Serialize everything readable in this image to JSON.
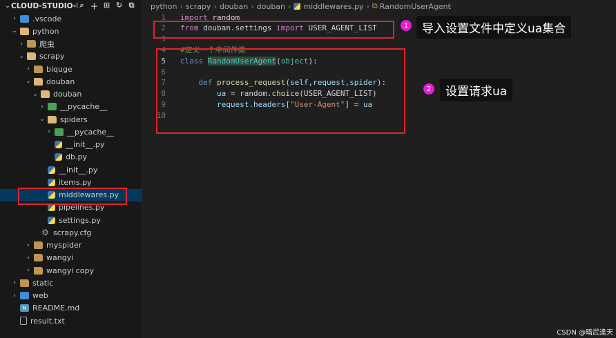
{
  "sidebar": {
    "title": "CLOUD-STUDIO-P...",
    "actions": [
      "search-icon",
      "new-file-icon",
      "new-folder-icon",
      "refresh-icon",
      "collapse-icon"
    ],
    "items": [
      {
        "label": ".vscode",
        "icon": "folder-vscode-icon",
        "chevron": "collapsed"
      },
      {
        "label": "python",
        "icon": "folder-icon",
        "chevron": "expanded"
      },
      {
        "label": "爬虫",
        "icon": "folder-icon",
        "chevron": "collapsed"
      },
      {
        "label": "scrapy",
        "icon": "folder-icon",
        "chevron": "expanded"
      },
      {
        "label": "biquge",
        "icon": "folder-icon",
        "chevron": "collapsed"
      },
      {
        "label": "douban",
        "icon": "folder-icon",
        "chevron": "expanded"
      },
      {
        "label": "douban",
        "icon": "folder-icon",
        "chevron": "expanded"
      },
      {
        "label": "__pycache__",
        "icon": "folder-pycache-icon",
        "chevron": "collapsed"
      },
      {
        "label": "spiders",
        "icon": "folder-icon",
        "chevron": "expanded"
      },
      {
        "label": "__pycache__",
        "icon": "folder-pycache-icon",
        "chevron": "collapsed"
      },
      {
        "label": "__init__.py",
        "icon": "python-file-icon"
      },
      {
        "label": "db.py",
        "icon": "python-file-icon"
      },
      {
        "label": "__init__.py",
        "icon": "python-file-icon"
      },
      {
        "label": "items.py",
        "icon": "python-file-icon"
      },
      {
        "label": "middlewares.py",
        "icon": "python-file-icon",
        "selected": true
      },
      {
        "label": "pipelines.py",
        "icon": "python-file-icon"
      },
      {
        "label": "settings.py",
        "icon": "python-file-icon"
      },
      {
        "label": "scrapy.cfg",
        "icon": "gear-icon"
      },
      {
        "label": "myspider",
        "icon": "folder-icon",
        "chevron": "collapsed"
      },
      {
        "label": "wangyi",
        "icon": "folder-icon",
        "chevron": "collapsed"
      },
      {
        "label": "wangyi copy",
        "icon": "folder-icon",
        "chevron": "collapsed"
      },
      {
        "label": "static",
        "icon": "folder-icon",
        "chevron": "collapsed"
      },
      {
        "label": "web",
        "icon": "folder-vscode-icon",
        "chevron": "collapsed"
      },
      {
        "label": "README.md",
        "icon": "markdown-file-icon"
      },
      {
        "label": "result.txt",
        "icon": "text-file-icon"
      }
    ]
  },
  "breadcrumb": [
    "python",
    "scrapy",
    "douban",
    "douban",
    "middlewares.py",
    "RandomUserAgent"
  ],
  "editor": {
    "active_line": 5,
    "lines": [
      {
        "n": "1",
        "tokens": [
          [
            "kw2",
            "import"
          ],
          [
            "txt",
            " random"
          ]
        ]
      },
      {
        "n": "2",
        "tokens": [
          [
            "kw2",
            "from"
          ],
          [
            "txt",
            " douban.settings "
          ],
          [
            "kw2",
            "import"
          ],
          [
            "txt",
            " USER_AGENT_LIST"
          ]
        ]
      },
      {
        "n": "3",
        "tokens": []
      },
      {
        "n": "4",
        "tokens": [
          [
            "cmt",
            "#定义一个中间件类"
          ]
        ]
      },
      {
        "n": "5",
        "tokens": [
          [
            "kw",
            "class"
          ],
          [
            "txt",
            " "
          ],
          [
            "cls-hl",
            "RandomUserAgent"
          ],
          [
            "txt",
            "("
          ],
          [
            "cls",
            "object"
          ],
          [
            "txt",
            "):"
          ]
        ]
      },
      {
        "n": "6",
        "tokens": []
      },
      {
        "n": "7",
        "tokens": [
          [
            "txt",
            "    "
          ],
          [
            "kw",
            "def"
          ],
          [
            "txt",
            " "
          ],
          [
            "fn",
            "process_request"
          ],
          [
            "txt",
            "("
          ],
          [
            "var",
            "self"
          ],
          [
            "txt",
            ","
          ],
          [
            "var",
            "request"
          ],
          [
            "txt",
            ","
          ],
          [
            "var",
            "spider"
          ],
          [
            "txt",
            "):"
          ]
        ]
      },
      {
        "n": "8",
        "tokens": [
          [
            "txt",
            "        "
          ],
          [
            "var",
            "ua"
          ],
          [
            "txt",
            " = random."
          ],
          [
            "fn",
            "choice"
          ],
          [
            "txt",
            "(USER_AGENT_LIST)"
          ]
        ]
      },
      {
        "n": "9",
        "tokens": [
          [
            "txt",
            "        "
          ],
          [
            "var",
            "request"
          ],
          [
            "txt",
            "."
          ],
          [
            "var",
            "headers"
          ],
          [
            "txt",
            "["
          ],
          [
            "str",
            "\"User-Agent\""
          ],
          [
            "txt",
            "] = "
          ],
          [
            "var",
            "ua"
          ]
        ]
      },
      {
        "n": "10",
        "tokens": []
      }
    ]
  },
  "annotations": [
    {
      "number": "1",
      "text": "导入设置文件中定义ua集合",
      "color": "#e91ed0"
    },
    {
      "number": "2",
      "text": "设置请求ua",
      "color": "#e91ed0"
    }
  ],
  "annotation_box_color": "#e5222b",
  "watermark": "CSDN @暗武逢天"
}
